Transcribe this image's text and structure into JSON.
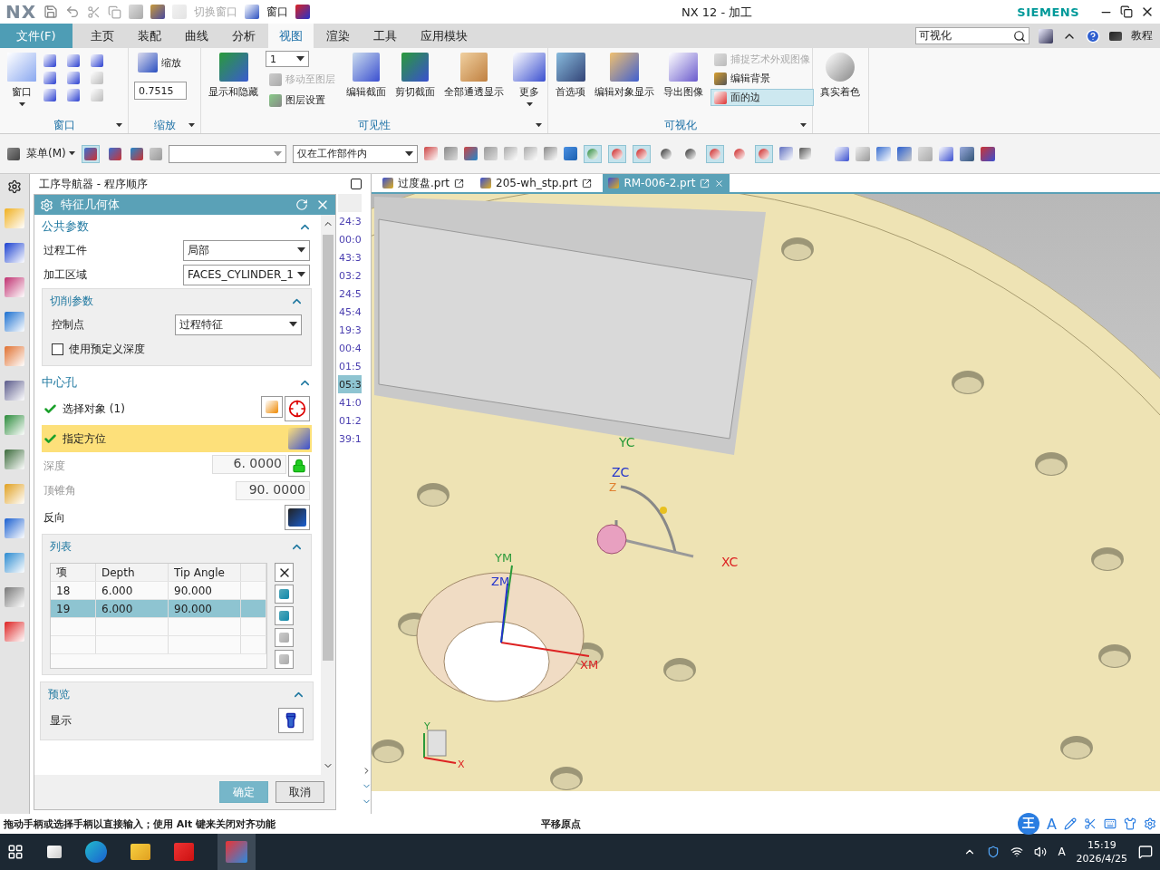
{
  "window": {
    "logo": "NX",
    "title": "NX 12 - 加工",
    "brand": "SIEMENS"
  },
  "quick_access": {
    "switch_window": {
      "label": "切换窗口",
      "disabled": true
    },
    "window_menu": "窗口"
  },
  "menu_tabs": [
    {
      "label": "文件(F)",
      "kind": "file",
      "selected": false
    },
    {
      "label": "主页",
      "kind": "tab",
      "selected": false
    },
    {
      "label": "装配",
      "kind": "tab",
      "selected": false
    },
    {
      "label": "曲线",
      "kind": "tab",
      "selected": false
    },
    {
      "label": "分析",
      "kind": "tab",
      "selected": false
    },
    {
      "label": "视图",
      "kind": "tab",
      "selected": true
    },
    {
      "label": "渲染",
      "kind": "tab",
      "selected": false
    },
    {
      "label": "工具",
      "kind": "tab",
      "selected": false
    },
    {
      "label": "应用模块",
      "kind": "tab",
      "selected": false
    }
  ],
  "command_search": {
    "value": "可视化"
  },
  "help_link": "教程",
  "ribbon": {
    "window_group": {
      "label": "窗口",
      "button": "窗口"
    },
    "zoom_group": {
      "label": "缩放",
      "button": "缩放",
      "scale": "0.7515"
    },
    "visibility_group": {
      "label": "可见性",
      "show_hide": "显示和隐藏",
      "layer_select": "1",
      "move_to_layer": {
        "label": "移动至图层",
        "disabled": true
      },
      "layer_settings": {
        "label": "图层设置",
        "disabled": false
      },
      "edit_section": "编辑截面",
      "clip_section": "剪切截面",
      "translucency": "全部通透显示",
      "more": "更多"
    },
    "visualization_group": {
      "label": "可视化",
      "preferences": "首选项",
      "edit_object_display": "编辑对象显示",
      "export_image": "导出图像",
      "capture_studio": {
        "label": "捕捉艺术外观图像",
        "disabled": true
      },
      "edit_background": {
        "label": "编辑背景",
        "selected": false
      },
      "face_edges": {
        "label": "面的边",
        "selected": true
      }
    },
    "true_shading": "真实着色"
  },
  "toolbar": {
    "menu": "菜单(M)",
    "scope": "仅在工作部件内",
    "selection_toggles": [
      {
        "selected": true
      },
      {
        "selected": false
      }
    ],
    "snap_toggles": [
      {
        "selected": true
      },
      {
        "selected": true
      },
      {
        "selected": true
      },
      {
        "selected": false
      },
      {
        "selected": false
      },
      {
        "selected": true
      },
      {
        "selected": false
      },
      {
        "selected": true
      }
    ]
  },
  "navigator": {
    "title": "工序导航器 - 程序顺序",
    "times": [
      {
        "text": "24:3",
        "selected": false
      },
      {
        "text": "00:0",
        "selected": false
      },
      {
        "text": "43:3",
        "selected": false
      },
      {
        "text": "03:2",
        "selected": false
      },
      {
        "text": "24:5",
        "selected": false
      },
      {
        "text": "45:4",
        "selected": false
      },
      {
        "text": "19:3",
        "selected": false
      },
      {
        "text": "00:4",
        "selected": false
      },
      {
        "text": "01:5",
        "selected": false
      },
      {
        "text": "05:3",
        "selected": true
      },
      {
        "text": "41:0",
        "selected": false
      },
      {
        "text": "01:2",
        "selected": false
      },
      {
        "text": "39:1",
        "selected": false
      }
    ]
  },
  "file_tabs": [
    {
      "label": "过度盘.prt",
      "selected": false
    },
    {
      "label": "205-wh_stp.prt",
      "selected": false
    },
    {
      "label": "RM-006-2.prt",
      "selected": true
    }
  ],
  "dialog": {
    "title": "特征几何体",
    "common": {
      "heading": "公共参数",
      "expanded": true,
      "fields": [
        {
          "label": "过程工件",
          "value": "局部"
        },
        {
          "label": "加工区域",
          "value": "FACES_CYLINDER_1"
        }
      ],
      "cut_params": {
        "heading": "切削参数",
        "expanded": true,
        "control_point": {
          "label": "控制点",
          "value": "过程特征"
        },
        "predefined_depth": {
          "label": "使用预定义深度",
          "checked": false
        }
      }
    },
    "center_hole": {
      "heading": "中心孔",
      "expanded": true,
      "select_object": {
        "label": "选择对象 (1)",
        "done": true
      },
      "orientation": {
        "label": "指定方位",
        "done": true,
        "selected": true
      },
      "depth": {
        "label": "深度",
        "value": "6. 0000",
        "disabled": true
      },
      "tip_angle": {
        "label": "顶锥角",
        "value": "90. 0000",
        "disabled": true
      },
      "reverse": "反向",
      "list": {
        "heading": "列表",
        "expanded": true,
        "columns": [
          "项",
          "Depth",
          "Tip Angle"
        ],
        "rows": [
          {
            "cells": [
              "18",
              "6.000",
              "90.000"
            ],
            "selected": false
          },
          {
            "cells": [
              "19",
              "6.000",
              "90.000"
            ],
            "selected": true
          }
        ]
      }
    },
    "preview": {
      "heading": "预览",
      "expanded": true,
      "show": "显示"
    },
    "buttons": {
      "ok": "确定",
      "cancel": "取消"
    }
  },
  "viewport": {
    "labels": {
      "yc": "YC",
      "zc": "ZC",
      "z_small": "Z",
      "xc": "XC",
      "ym": "YM",
      "zm": "ZM",
      "xm": "XM"
    },
    "triad": {
      "y": "Y",
      "x": "X"
    }
  },
  "status_bar": {
    "prompt": "拖动手柄或选择手柄以直接输入；使用 Alt 键来关闭对齐功能",
    "mode": "平移原点"
  },
  "ime_bar": {
    "logo": "王",
    "letter": "A"
  },
  "taskbar": {
    "tray_letter": "A",
    "time": "15:19",
    "date": "2026/4/25"
  }
}
